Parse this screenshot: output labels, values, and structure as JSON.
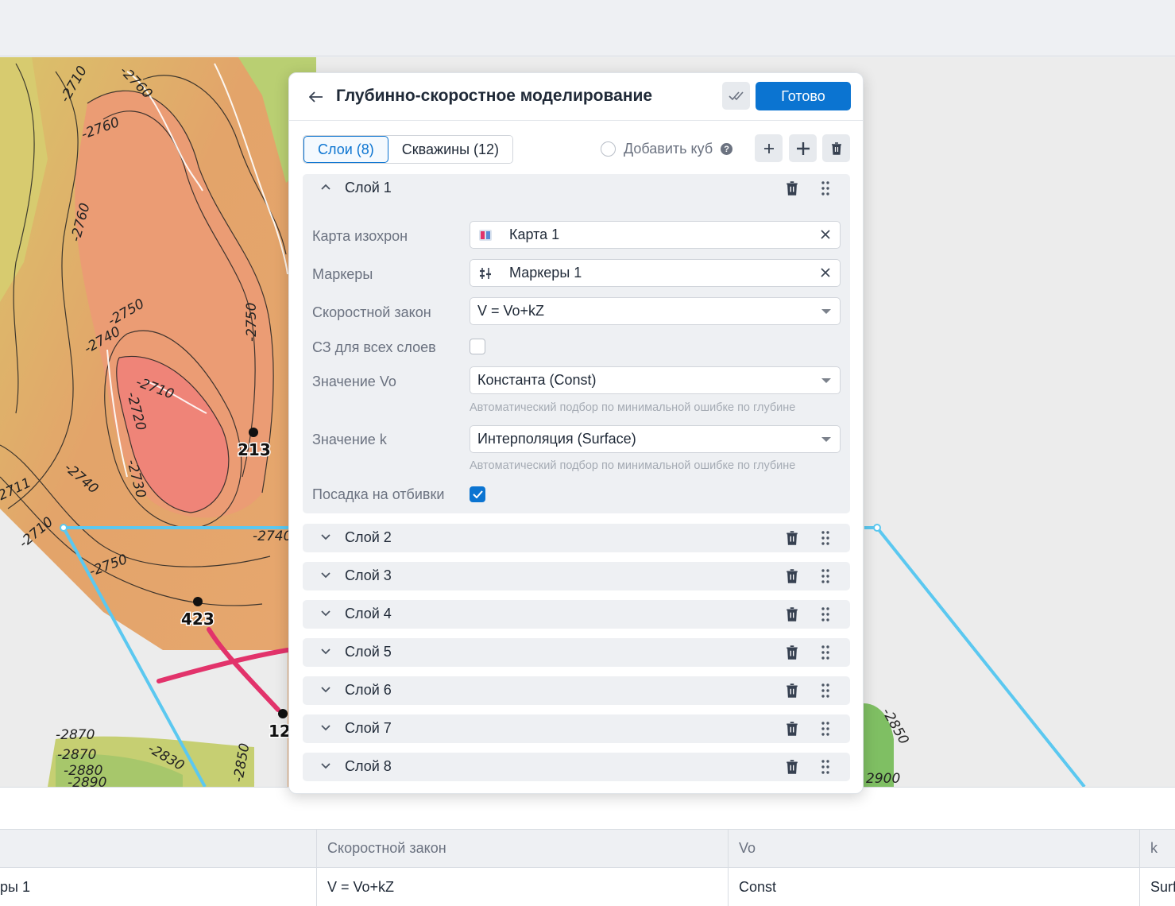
{
  "panel": {
    "title": "Глубинно-скоростное моделирование",
    "done_label": "Готово",
    "tabs": [
      {
        "label": "Слои (8)",
        "active": true
      },
      {
        "label": "Скважины (12)",
        "active": false
      }
    ],
    "add_cube_label": "Добавить куб",
    "layer1": {
      "name": "Слой 1",
      "fields": {
        "isochron_map": {
          "label": "Карта изохрон",
          "value": "Карта 1"
        },
        "markers": {
          "label": "Маркеры",
          "value": "Маркеры 1"
        },
        "velocity_law": {
          "label": "Скоростной закон",
          "value": "V = Vo+kZ"
        },
        "sz_all_layers": {
          "label": "СЗ для всех слоев",
          "checked": false
        },
        "vo_value": {
          "label": "Значение Vo",
          "value": "Константа (Const)",
          "hint": "Автоматический подбор по минимальной ошибке по глубине"
        },
        "k_value": {
          "label": "Значение k",
          "value": "Интерполяция (Surface)",
          "hint": "Автоматический подбор по минимальной ошибке по глубине"
        },
        "fit_to_picks": {
          "label": "Посадка на отбивки",
          "checked": true
        }
      }
    },
    "collapsed_layers": [
      "Слой 2",
      "Слой 3",
      "Слой 4",
      "Слой 5",
      "Слой 6",
      "Слой 7",
      "Слой 8"
    ]
  },
  "map": {
    "well_labels": [
      "213",
      "423",
      "12"
    ],
    "contour_labels": [
      "-2710",
      "-2760",
      "-2760",
      "-2760",
      "-2750",
      "-2750",
      "-2740",
      "-2720",
      "-2730",
      "-2740",
      "-2710",
      "-2750",
      "-2740",
      "-2870",
      "-2830",
      "-2850",
      "-2880",
      "-2890",
      "-2850",
      "-2870",
      "2900",
      "-2710",
      "-2711"
    ],
    "colors": {
      "route": "#5bc8f0",
      "well_path": "#e2336b"
    }
  },
  "table": {
    "headers": [
      "",
      "Скоростной закон",
      "Vo",
      "k"
    ],
    "row": [
      "ры 1",
      "V = Vo+kZ",
      "Const",
      "Surf"
    ]
  },
  "colors": {
    "accent": "#0b74d1"
  }
}
